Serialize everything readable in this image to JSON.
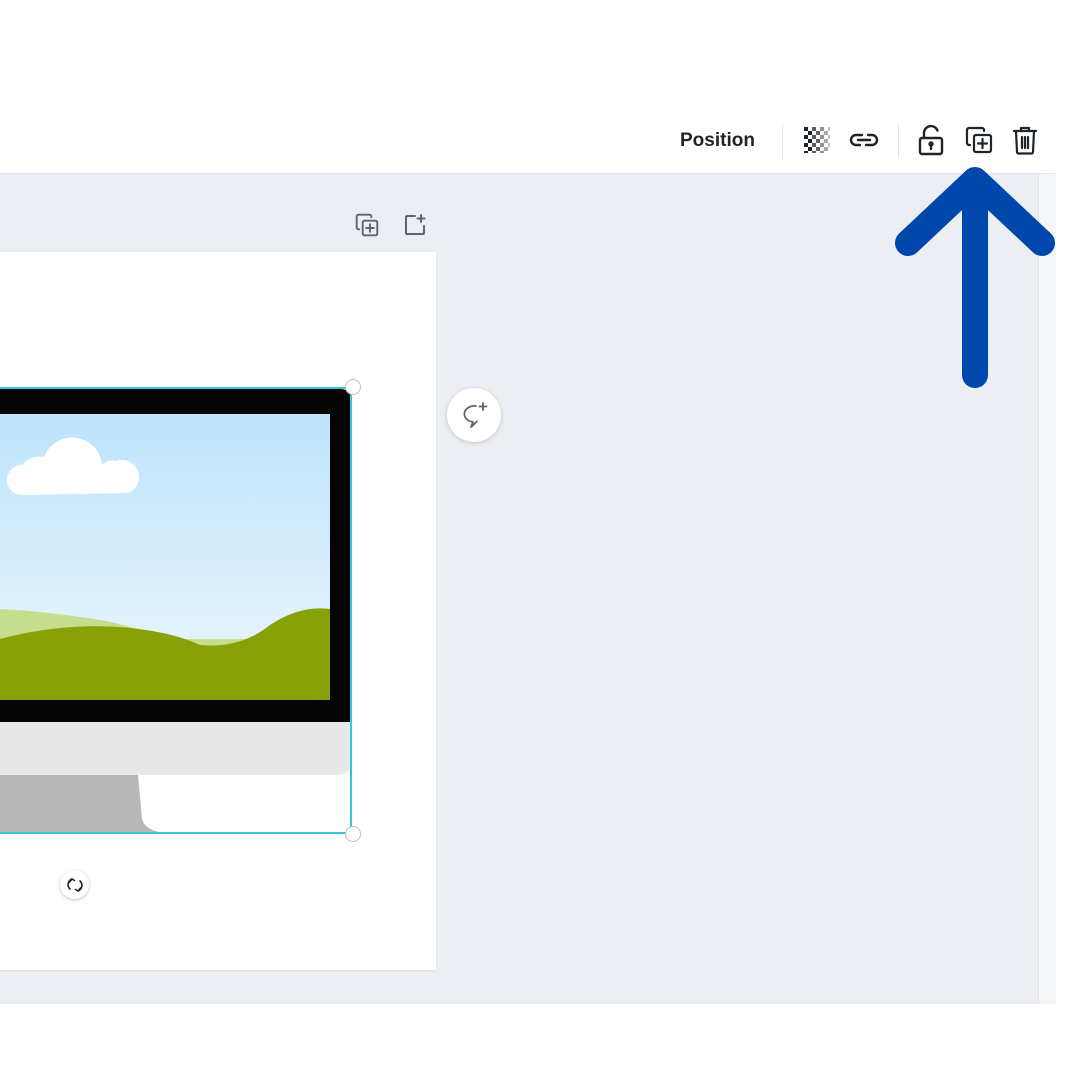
{
  "toolbar": {
    "position_label": "Position",
    "icons": [
      "transparency-icon",
      "link-icon",
      "lock-icon",
      "duplicate-icon",
      "trash-icon"
    ]
  },
  "page_actions": {
    "icons": [
      "duplicate-page-icon",
      "add-page-icon"
    ]
  },
  "canvas": {
    "selected_element": "monitor-illustration",
    "selection_color": "#35c6d3"
  },
  "annotation": {
    "arrow_color": "#0047ab",
    "points_to": "duplicate-icon"
  },
  "colors": {
    "workspace_bg": "#ebeff3",
    "toolbar_bg": "#ffffff",
    "text_primary": "#1f2428"
  }
}
